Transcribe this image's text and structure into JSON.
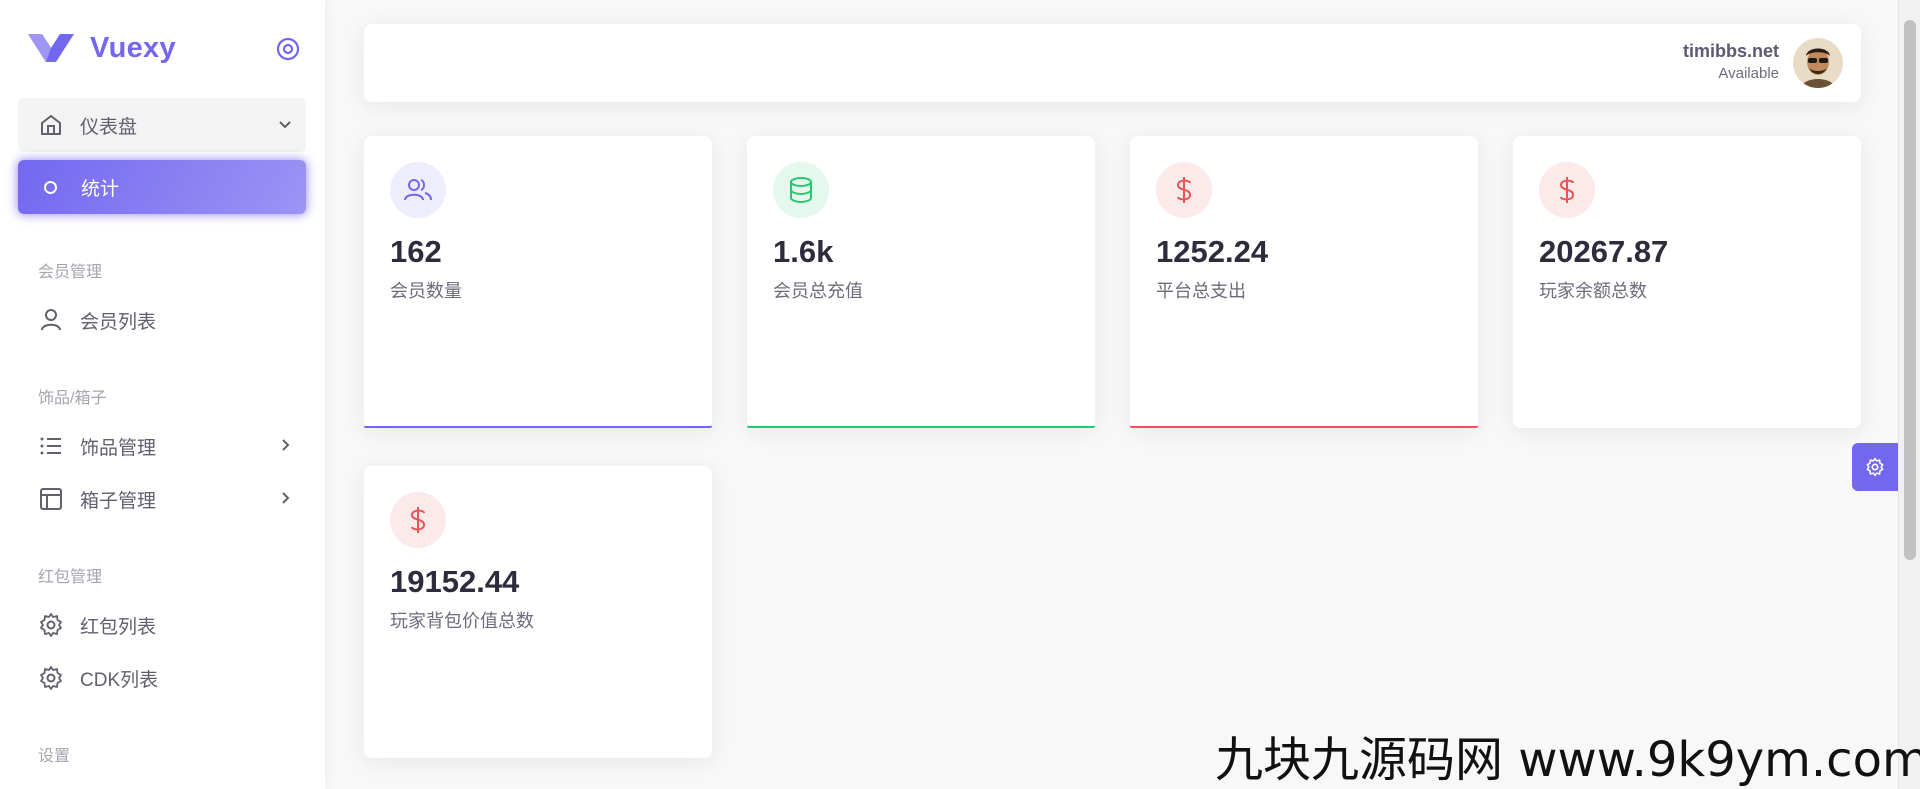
{
  "brand": {
    "name": "Vuexy",
    "accent": "#7367f0"
  },
  "sidebar": {
    "dashboard": {
      "label": "仪表盘",
      "icon": "home-icon"
    },
    "active_item": {
      "label": "统计"
    },
    "sections": [
      {
        "title": "会员管理",
        "items": [
          {
            "label": "会员列表",
            "icon": "user-icon"
          }
        ]
      },
      {
        "title": "饰品/箱子",
        "items": [
          {
            "label": "饰品管理",
            "icon": "list-icon"
          },
          {
            "label": "箱子管理",
            "icon": "layout-icon"
          }
        ]
      },
      {
        "title": "红包管理",
        "items": [
          {
            "label": "红包列表",
            "icon": "gear-icon"
          },
          {
            "label": "CDK列表",
            "icon": "gear-icon"
          }
        ]
      },
      {
        "title": "设置",
        "items": []
      }
    ]
  },
  "navbar": {
    "user_name": "timibbs.net",
    "user_status": "Available"
  },
  "stats": [
    {
      "value": "162",
      "label": "会员数量",
      "icon": "users-icon",
      "color": "#7367f0",
      "bg": "#eeedfd"
    },
    {
      "value": "1.6k",
      "label": "会员总充值",
      "icon": "database-icon",
      "color": "#28c76f",
      "bg": "#e5f8ed"
    },
    {
      "value": "1252.24",
      "label": "平台总支出",
      "icon": "dollar-icon",
      "color": "#ea5455",
      "bg": "#fceaea"
    },
    {
      "value": "20267.87",
      "label": "玩家余额总数",
      "icon": "dollar-icon",
      "color": "#ea5455",
      "bg": "#fceaea"
    },
    {
      "value": "19152.44",
      "label": "玩家背包价值总数",
      "icon": "dollar-icon",
      "color": "#ea5455",
      "bg": "#fceaea"
    }
  ],
  "watermark": "九块九源码网 www.9k9ym.com"
}
